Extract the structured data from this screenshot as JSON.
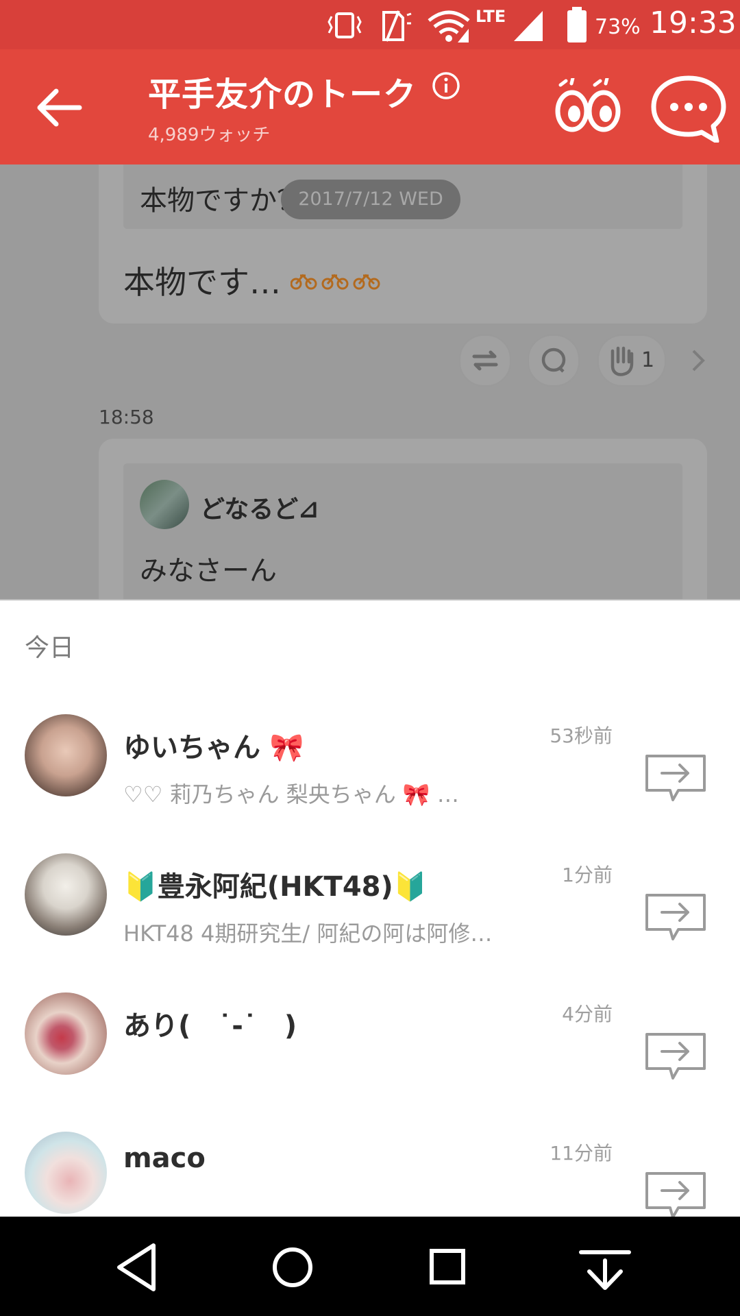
{
  "status_bar": {
    "battery_percent": "73%",
    "time": "19:33",
    "network": "LTE",
    "icons": [
      "vibrate-icon",
      "no-sim-icon",
      "wifi-icon",
      "lte-icon",
      "signal-icon",
      "battery-icon"
    ]
  },
  "header": {
    "title": "平手友介のトーク",
    "watch_count": "4,989ウォッチ",
    "icons": [
      "back-arrow-icon",
      "info-icon",
      "eyes-icon",
      "chat-bubble-icon"
    ]
  },
  "background": {
    "date_pill": "2017/7/12 WED",
    "quoted_text": "本物ですか？😺",
    "message_text": "本物です…",
    "reaction_count": "1",
    "message_time": "18:58",
    "quote_author": "どなるど⊿",
    "quote_body": "みなさーん"
  },
  "sheet": {
    "section_label": "今日",
    "rows": [
      {
        "name": "ゆいちゃん 🎀",
        "bio": "♡♡ 莉乃ちゃん 梨央ちゃん 🎀 …",
        "time": "53秒前"
      },
      {
        "name": "🔰豊永阿紀(HKT48)🔰",
        "bio": "HKT48 4期研究生/ 阿紀の阿は阿修…",
        "time": "1分前"
      },
      {
        "name": "あり(　˙-˙　)",
        "bio": "",
        "time": "4分前"
      },
      {
        "name": "maco",
        "bio": "",
        "time": "11分前"
      }
    ]
  },
  "nav_bar": {
    "icons": [
      "back-triangle-icon",
      "home-circle-icon",
      "recents-square-icon",
      "notification-pull-icon"
    ]
  },
  "colors": {
    "status_bar": "#d8403a",
    "header": "#e2473d",
    "dim_overlay": "#9b9b9b",
    "nav_bar": "#000000"
  }
}
